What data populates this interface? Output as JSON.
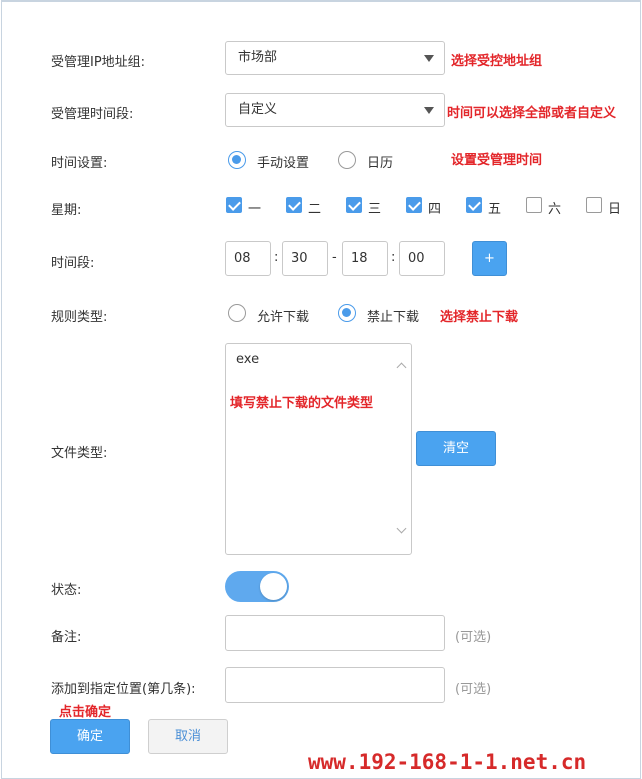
{
  "form": {
    "ip_group": {
      "label": "受管理IP地址组:",
      "value": "市场部",
      "note": "选择受控地址组"
    },
    "time_slot": {
      "label": "受管理时间段:",
      "value": "自定义",
      "note": "时间可以选择全部或者自定义"
    },
    "time_setting": {
      "label": "时间设置:",
      "options": [
        "手动设置",
        "日历"
      ],
      "selected": "手动设置",
      "note": "设置受管理时间"
    },
    "weekdays": {
      "label": "星期:",
      "days": [
        {
          "label": "一",
          "checked": true
        },
        {
          "label": "二",
          "checked": true
        },
        {
          "label": "三",
          "checked": true
        },
        {
          "label": "四",
          "checked": true
        },
        {
          "label": "五",
          "checked": true
        },
        {
          "label": "六",
          "checked": false
        },
        {
          "label": "日",
          "checked": false
        }
      ]
    },
    "period": {
      "label": "时间段:",
      "start_hour": "08",
      "start_min": "30",
      "end_hour": "18",
      "end_min": "00",
      "colon": ":",
      "dash": "-",
      "add_label": "+"
    },
    "rule_type": {
      "label": "规则类型:",
      "options": [
        "允许下载",
        "禁止下载"
      ],
      "selected": "禁止下载",
      "note": "选择禁止下载"
    },
    "file_type": {
      "label": "文件类型:",
      "value": "exe",
      "note": "填写禁止下载的文件类型",
      "clear_label": "清空"
    },
    "status": {
      "label": "状态:",
      "enabled": true
    },
    "remark": {
      "label": "备注:",
      "hint": "(可选)",
      "value": ""
    },
    "position": {
      "label": "添加到指定位置(第几条):",
      "hint": "(可选)",
      "value": ""
    },
    "confirm_note": "点击确定",
    "confirm_label": "确定",
    "cancel_label": "取消"
  },
  "watermark": "www.192-168-1-1.net.cn",
  "colors": {
    "accent": "#4a9bea",
    "annotation": "#e3262a",
    "toggle": "#5fa9ee"
  }
}
